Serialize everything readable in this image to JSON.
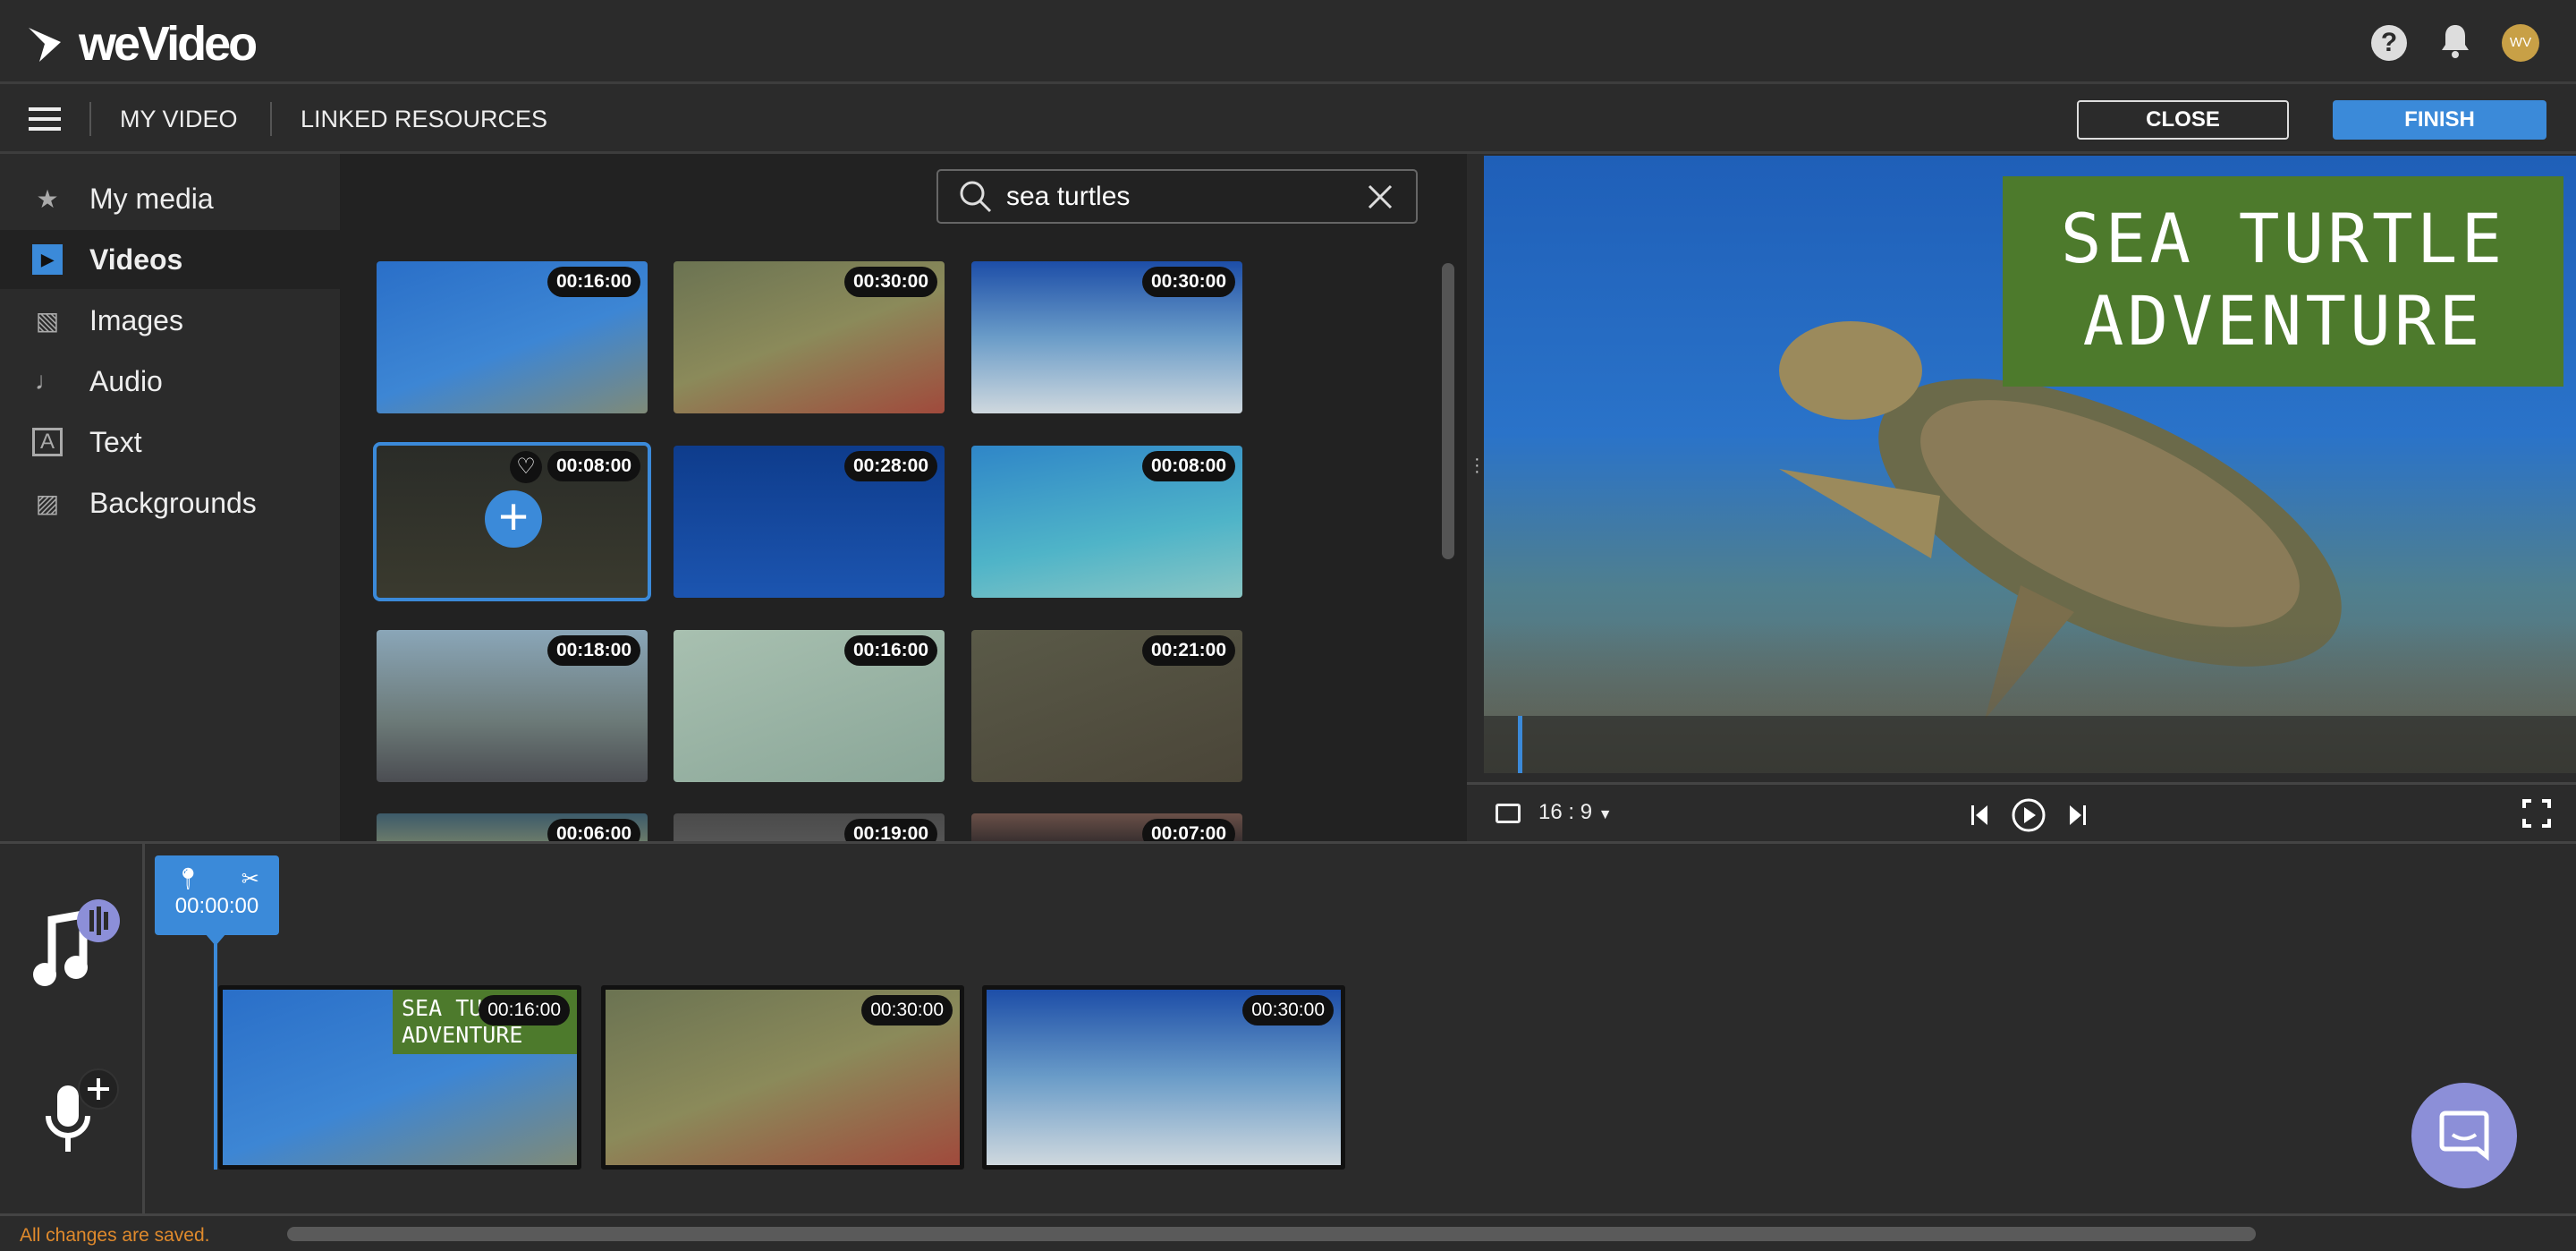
{
  "app": {
    "logo": "weVideo"
  },
  "topbar": {
    "help_icon": "question-circle-icon",
    "notifications_icon": "bell-icon",
    "avatar_initials": "WV"
  },
  "nav": {
    "menu_icon": "hamburger-icon",
    "my_video": "MY VIDEO",
    "linked_resources": "LINKED RESOURCES",
    "close": "CLOSE",
    "finish": "FINISH"
  },
  "sidebar": {
    "items": [
      {
        "label": "My media",
        "icon": "folder-star-icon"
      },
      {
        "label": "Videos",
        "icon": "video-play-icon",
        "active": true
      },
      {
        "label": "Images",
        "icon": "image-icon"
      },
      {
        "label": "Audio",
        "icon": "music-note-icon"
      },
      {
        "label": "Text",
        "icon": "text-icon"
      },
      {
        "label": "Backgrounds",
        "icon": "backgrounds-icon"
      }
    ]
  },
  "search": {
    "value": "sea turtles"
  },
  "media": {
    "items": [
      {
        "duration": "00:16:00"
      },
      {
        "duration": "00:30:00"
      },
      {
        "duration": "00:30:00"
      },
      {
        "duration": "00:08:00",
        "selected": true
      },
      {
        "duration": "00:28:00"
      },
      {
        "duration": "00:08:00"
      },
      {
        "duration": "00:18:00"
      },
      {
        "duration": "00:16:00"
      },
      {
        "duration": "00:21:00"
      },
      {
        "duration": "00:06:00"
      },
      {
        "duration": "00:19:00"
      },
      {
        "duration": "00:07:00"
      }
    ]
  },
  "preview": {
    "title_line1": "SEA TURTLE",
    "title_line2": "ADVENTURE",
    "aspect_ratio": "16 : 9"
  },
  "timeline": {
    "playhead_time": "00:00:00",
    "clips": [
      {
        "duration": "00:16:00",
        "title1": "SEA TURTLE",
        "title2": "ADVENTURE"
      },
      {
        "duration": "00:30:00"
      },
      {
        "duration": "00:30:00"
      }
    ]
  },
  "status": {
    "text": "All changes are saved."
  },
  "colors": {
    "accent": "#3b8ad9",
    "title_bg": "#4d7a2c",
    "status": "#e08a2c",
    "chat": "#8c8fd8"
  }
}
